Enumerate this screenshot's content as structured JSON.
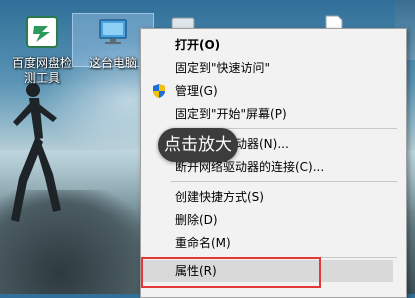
{
  "desktop": {
    "icons": [
      {
        "label_line1": "百度网盘检",
        "label_line2": "测工具",
        "icon": "baidu-netdisk-app-icon"
      },
      {
        "label_line1": "这台电脑",
        "icon": "this-pc-monitor-icon"
      }
    ]
  },
  "context_menu": {
    "items": [
      {
        "label": "打开(O)",
        "bold": true
      },
      {
        "label": "固定到\"快速访问\""
      },
      {
        "label": "管理(G)",
        "icon": "uac-shield-icon"
      },
      {
        "label": "固定到\"开始\"屏幕(P)"
      },
      {
        "label": "映射网络驱动器(N)..."
      },
      {
        "label": "断开网络驱动器的连接(C)..."
      },
      {
        "label": "创建快捷方式(S)"
      },
      {
        "label": "删除(D)"
      },
      {
        "label": "重命名(M)"
      },
      {
        "label": "属性(R)",
        "highlighted": true
      }
    ]
  },
  "overlay": {
    "tooltip": "点击放大"
  },
  "colors": {
    "highlight_box": "#e53935",
    "menu_bg": "#f2f2f2",
    "tooltip_bg": "#3c3c3c"
  }
}
